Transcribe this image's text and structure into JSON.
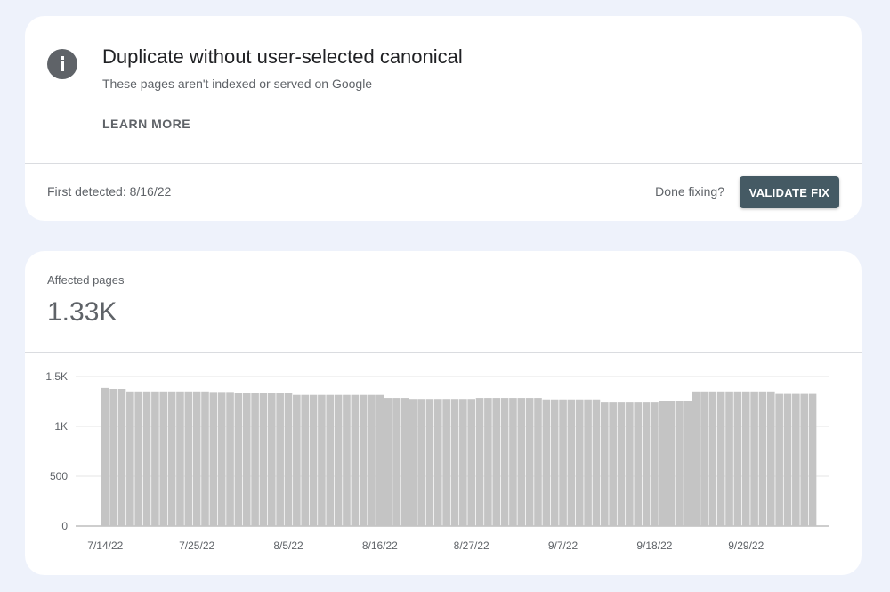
{
  "issue": {
    "title": "Duplicate without user-selected canonical",
    "subtitle": "These pages aren't indexed or served on Google",
    "learn_more": "LEARN MORE",
    "icon": "info-icon"
  },
  "detection": {
    "first_detected": "First detected: 8/16/22",
    "done_fixing": "Done fixing?",
    "validate_fix": "VALIDATE FIX"
  },
  "colors": {
    "background": "#eef2fb",
    "button": "#455a64",
    "bars": "#c4c4c4"
  },
  "affected": {
    "label": "Affected pages",
    "value": "1.33K"
  },
  "chart_data": {
    "type": "bar",
    "title": "",
    "xlabel": "",
    "ylabel": "",
    "ylim": [
      0,
      1500
    ],
    "yticks": [
      {
        "value": 0,
        "label": "0"
      },
      {
        "value": 500,
        "label": "500"
      },
      {
        "value": 1000,
        "label": "1K"
      },
      {
        "value": 1500,
        "label": "1.5K"
      }
    ],
    "x_start": "7/14/22",
    "x_tick_labels": [
      "7/14/22",
      "7/25/22",
      "8/5/22",
      "8/16/22",
      "8/27/22",
      "9/7/22",
      "9/18/22",
      "9/29/22"
    ],
    "x_tick_indices": [
      0,
      11,
      22,
      33,
      44,
      55,
      66,
      77
    ],
    "grid": true,
    "series": [
      {
        "values": [
          1385,
          1375,
          1375,
          1350,
          1350,
          1350,
          1350,
          1350,
          1350,
          1350,
          1350,
          1350,
          1350,
          1345,
          1345,
          1345,
          1335,
          1335,
          1335,
          1335,
          1335,
          1335,
          1335,
          1315,
          1315,
          1315,
          1315,
          1315,
          1315,
          1315,
          1315,
          1315,
          1315,
          1315,
          1285,
          1285,
          1285,
          1275,
          1275,
          1275,
          1275,
          1275,
          1275,
          1275,
          1275,
          1285,
          1285,
          1285,
          1285,
          1285,
          1285,
          1285,
          1285,
          1270,
          1270,
          1270,
          1270,
          1270,
          1270,
          1270,
          1240,
          1240,
          1240,
          1240,
          1240,
          1240,
          1240,
          1250,
          1250,
          1250,
          1250,
          1350,
          1350,
          1350,
          1350,
          1350,
          1350,
          1350,
          1350,
          1350,
          1350,
          1325,
          1325,
          1325,
          1325,
          1325
        ]
      }
    ]
  }
}
